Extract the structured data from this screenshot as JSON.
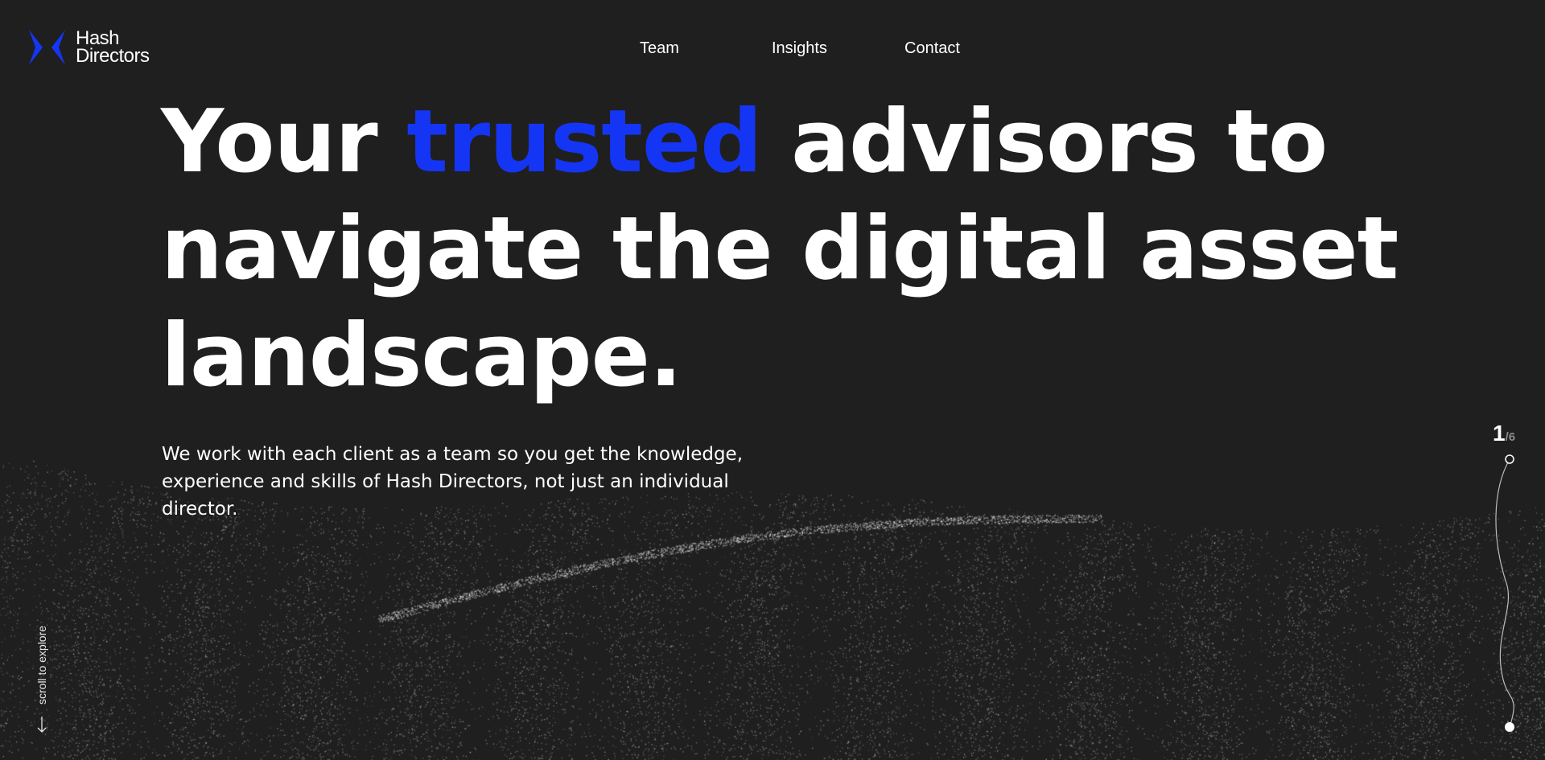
{
  "brand": {
    "name_line1": "Hash",
    "name_line2": "Directors",
    "accent_color": "#1535f5",
    "logo_icon": "hash-directors-chevrons-icon"
  },
  "nav": {
    "items": [
      {
        "label": "Team"
      },
      {
        "label": "Insights"
      },
      {
        "label": "Contact"
      }
    ]
  },
  "hero": {
    "part1": "Your ",
    "accent_word": "trusted",
    "part2": " advisors to navigate the digital asset landscape."
  },
  "intro": {
    "text": "We work with each client as a team so you get the knowledge, experience and skills of Hash Directors, not just an individual director."
  },
  "scroll": {
    "label": "scroll to explore",
    "icon": "arrow-down-icon"
  },
  "pagination": {
    "current": "1",
    "total": "/6"
  },
  "colors": {
    "background": "#1f1f1f",
    "text": "#ffffff",
    "accent": "#1535f5"
  }
}
